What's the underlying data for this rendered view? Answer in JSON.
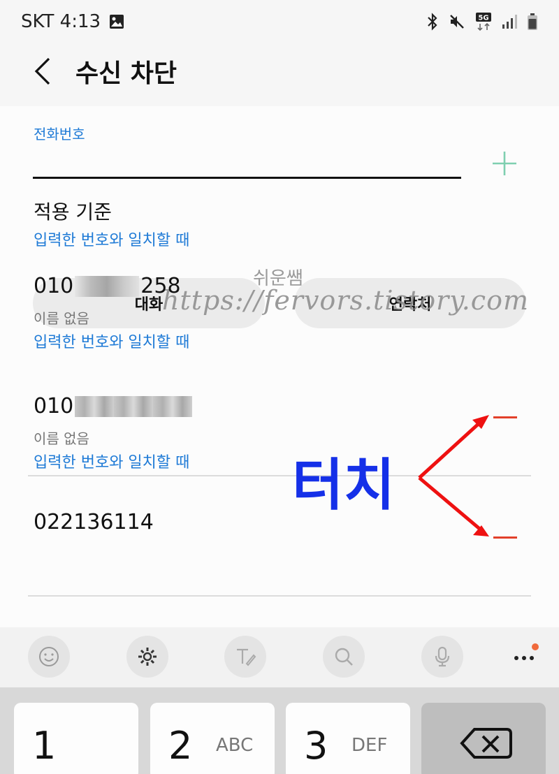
{
  "status_bar": {
    "carrier_time": "SKT 4:13",
    "network": "5G"
  },
  "header": {
    "title": "수신 차단"
  },
  "form": {
    "phone_label": "전화번호",
    "phone_value": "",
    "criteria_title": "적용 기준",
    "criteria_value": "입력한 번호와 일치할 때"
  },
  "buttons": {
    "conversations": "대화",
    "contacts": "연락처"
  },
  "watermark": {
    "name": "쉬운쌤",
    "url": "https://fervors.tistory.com"
  },
  "blocked_numbers": [
    {
      "prefix": "010",
      "suffix": "258",
      "name": "이름 없음",
      "criteria": "입력한 번호와 일치할 때"
    },
    {
      "prefix": "010",
      "suffix": "",
      "name": "이름 없음",
      "criteria": "입력한 번호와 일치할 때"
    },
    {
      "prefix": "022136114",
      "suffix": "",
      "name": "",
      "criteria": ""
    }
  ],
  "annotation": {
    "label": "터치",
    "color": "#1530e8",
    "arrow_color": "#ee1111"
  },
  "keyboard": {
    "toolbar_icons": [
      "emoji-icon",
      "settings-icon",
      "handwriting-icon",
      "search-icon",
      "mic-icon",
      "more-icon"
    ],
    "keys": [
      {
        "digit": "1",
        "letters": ""
      },
      {
        "digit": "2",
        "letters": "ABC"
      },
      {
        "digit": "3",
        "letters": "DEF"
      }
    ]
  },
  "colors": {
    "accent": "#1e7ad6",
    "remove": "#e2402a",
    "add": "#7fcfb0"
  }
}
